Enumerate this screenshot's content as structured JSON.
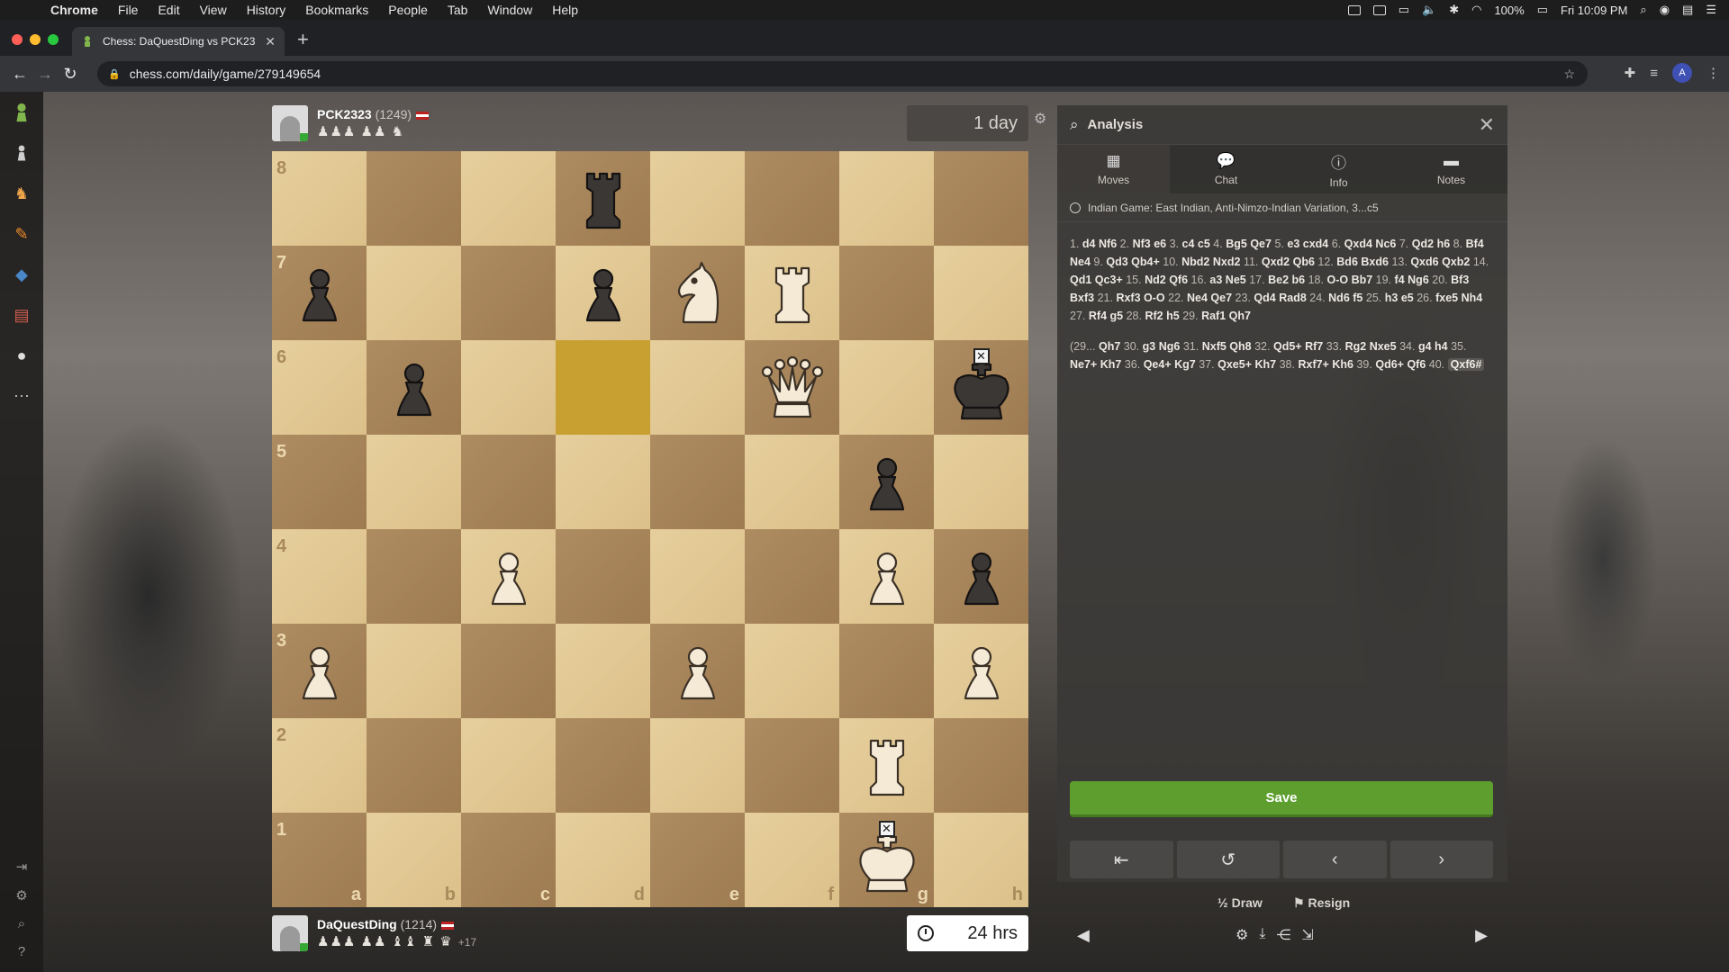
{
  "menubar": {
    "app": "Chrome",
    "items": [
      "File",
      "Edit",
      "View",
      "History",
      "Bookmarks",
      "People",
      "Tab",
      "Window",
      "Help"
    ],
    "battery": "100%",
    "clock": "Fri 10:09 PM"
  },
  "browser": {
    "tab_title": "Chess: DaQuestDing vs PCK23",
    "url": "chess.com/daily/game/279149654",
    "avatar_letter": "A"
  },
  "top_player": {
    "name": "PCK2323",
    "rating": "(1249)",
    "captured": "♟♟♟ ♟♟ ♞",
    "clock": "1 day"
  },
  "bottom_player": {
    "name": "DaQuestDing",
    "rating": "(1214)",
    "captured": "♟♟♟ ♟♟ ♝♝ ♜ ♛",
    "advantage": "+17",
    "clock": "24 hrs"
  },
  "board": {
    "ranks": [
      "8",
      "7",
      "6",
      "5",
      "4",
      "3",
      "2",
      "1"
    ],
    "files": [
      "a",
      "b",
      "c",
      "d",
      "e",
      "f",
      "g",
      "h"
    ],
    "highlight": [
      "d6"
    ],
    "position": {
      "d8": "bR",
      "a7": "bP",
      "d7": "bP",
      "e7": "wN",
      "f7": "wR",
      "b6": "bP",
      "f6": "wQ",
      "h6": "bK",
      "g5": "bP",
      "c4": "wP",
      "g4": "wP",
      "h4": "bP",
      "a3": "wP",
      "e3": "wP",
      "h3": "wP",
      "g2": "wR",
      "g1": "wK"
    },
    "checkmated": [
      "h6",
      "g1"
    ],
    "colors": {
      "light": "#e3c995",
      "dark": "#a8855a",
      "highlight": "#c8a032"
    }
  },
  "panel": {
    "title": "Analysis",
    "tabs": [
      {
        "label": "Moves",
        "icon": "board-icon"
      },
      {
        "label": "Chat",
        "icon": "chat-icon"
      },
      {
        "label": "Info",
        "icon": "info-icon"
      },
      {
        "label": "Notes",
        "icon": "notes-icon"
      }
    ],
    "opening": "Indian Game: East Indian, Anti-Nimzo-Indian Variation, 3...c5",
    "moves_main": [
      [
        "1.",
        "d4",
        "Nf6"
      ],
      [
        "2.",
        "Nf3",
        "e6"
      ],
      [
        "3.",
        "c4",
        "c5"
      ],
      [
        "4.",
        "Bg5",
        "Qe7"
      ],
      [
        "5.",
        "e3",
        "cxd4"
      ],
      [
        "6.",
        "Qxd4",
        "Nc6"
      ],
      [
        "7.",
        "Qd2",
        "h6"
      ],
      [
        "8.",
        "Bf4",
        "Ne4"
      ],
      [
        "9.",
        "Qd3",
        "Qb4+"
      ],
      [
        "10.",
        "Nbd2",
        "Nxd2"
      ],
      [
        "11.",
        "Qxd2",
        "Qb6"
      ],
      [
        "12.",
        "Bd6",
        "Bxd6"
      ],
      [
        "13.",
        "Qxd6",
        "Qxb2"
      ],
      [
        "14.",
        "Qd1",
        "Qc3+"
      ],
      [
        "15.",
        "Nd2",
        "Qf6"
      ],
      [
        "16.",
        "a3",
        "Ne5"
      ],
      [
        "17.",
        "Be2",
        "b6"
      ],
      [
        "18.",
        "O-O",
        "Bb7"
      ],
      [
        "19.",
        "f4",
        "Ng6"
      ],
      [
        "20.",
        "Bf3",
        "Bxf3"
      ],
      [
        "21.",
        "Rxf3",
        "O-O"
      ],
      [
        "22.",
        "Ne4",
        "Qe7"
      ],
      [
        "23.",
        "Qd4",
        "Rad8"
      ],
      [
        "24.",
        "Nd6",
        "f5"
      ],
      [
        "25.",
        "h3",
        "e5"
      ],
      [
        "26.",
        "fxe5",
        "Nh4"
      ],
      [
        "27.",
        "Rf4",
        "g5"
      ],
      [
        "28.",
        "Rf2",
        "h5"
      ],
      [
        "29.",
        "Raf1",
        "Qh7"
      ]
    ],
    "moves_cont": [
      [
        "(29...",
        "Qh7",
        ""
      ],
      [
        "30.",
        "g3",
        "Ng6"
      ],
      [
        "31.",
        "Nxf5",
        "Qh8"
      ],
      [
        "32.",
        "Qd5+",
        "Rf7"
      ],
      [
        "33.",
        "Rg2",
        "Nxe5"
      ],
      [
        "34.",
        "g4",
        "h4"
      ],
      [
        "35.",
        "Ne7+",
        "Kh7"
      ],
      [
        "36.",
        "Qe4+",
        "Kg7"
      ],
      [
        "37.",
        "Qxe5+",
        "Kh7"
      ],
      [
        "38.",
        "Rxf7+",
        "Kh6"
      ],
      [
        "39.",
        "Qd6+",
        "Qf6"
      ],
      [
        "40.",
        "Qxf6#",
        ""
      ]
    ],
    "save_label": "Save",
    "draw_label": "Draw",
    "draw_prefix": "½",
    "resign_label": "Resign"
  }
}
